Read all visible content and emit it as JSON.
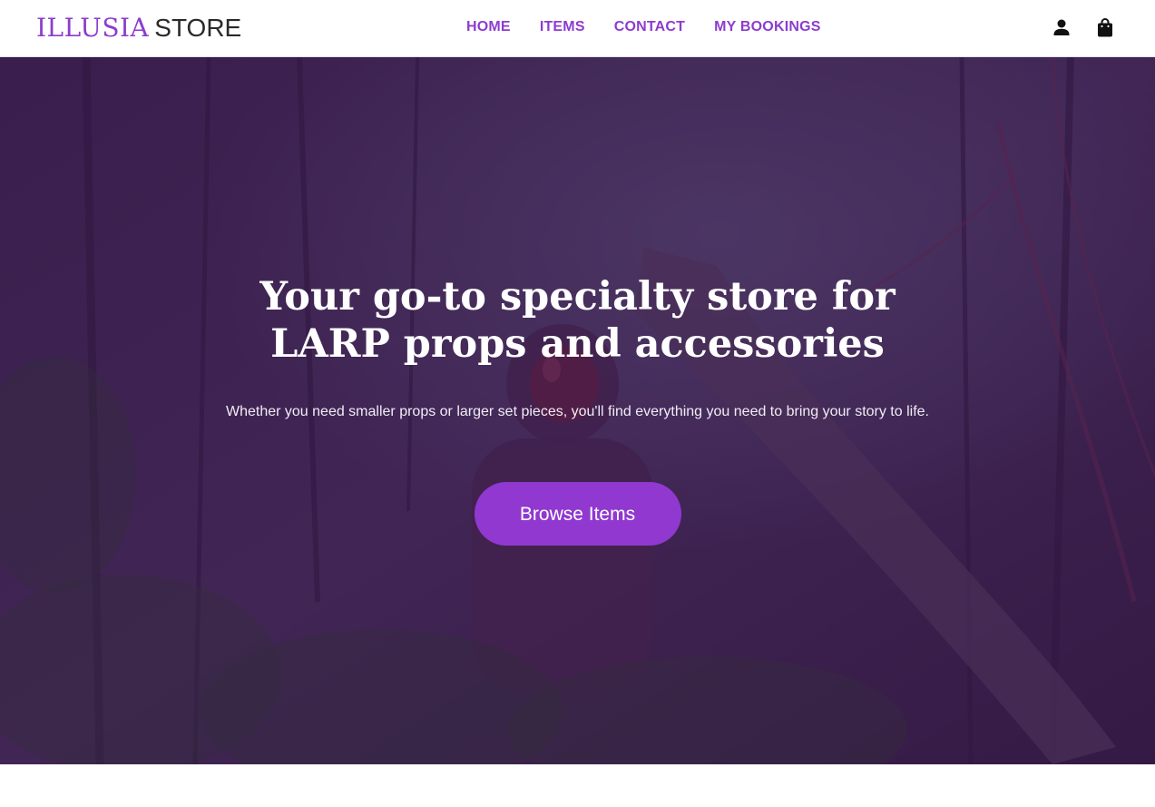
{
  "nav": {
    "brand": "ILLUSIA",
    "brand_suffix": "STORE",
    "links": [
      {
        "label": "HOME"
      },
      {
        "label": "ITEMS"
      },
      {
        "label": "CONTACT"
      },
      {
        "label": "MY BOOKINGS"
      }
    ],
    "icons": [
      "user-icon",
      "shopping-bag-icon"
    ]
  },
  "hero": {
    "title": "Your go-to specialty store for LARP props and accessories",
    "subtitle": "Whether you need smaller props or larger set pieces, you'll find everything you need to bring your story to life.",
    "cta_label": "Browse Items",
    "background": "astronaut-in-forest-photo"
  },
  "colors": {
    "accent": "#8d3ccf",
    "button": "#9038cf",
    "overlay": "#3a1a4a"
  }
}
